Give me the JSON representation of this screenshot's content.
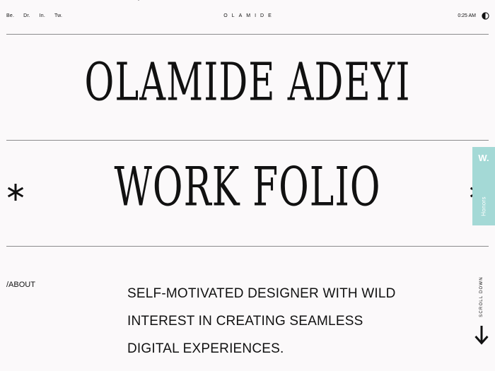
{
  "header": {
    "social_links": [
      {
        "label": "Be."
      },
      {
        "label": "Dr."
      },
      {
        "label": "In."
      },
      {
        "label": "Tw."
      }
    ],
    "brand": "OLAMIDE",
    "time": "0:25 AM",
    "theme_icon": "half-moon-icon"
  },
  "hero": {
    "name": "OLAMIDE ADEYI",
    "subtitle": "WORK FOLIO",
    "decor_icon": "asterisk-icon"
  },
  "side_tab": {
    "mark": "W.",
    "label": "Honors",
    "background": "#a4d9d6"
  },
  "about": {
    "label": "/ABOUT",
    "lines": [
      "SELF-MOTIVATED DESIGNER WITH WILD",
      "INTEREST IN CREATING SEAMLESS",
      "DIGITAL EXPERIENCES."
    ]
  },
  "scroll": {
    "label": "SCROLL DOWN",
    "icon": "arrow-down-icon"
  }
}
